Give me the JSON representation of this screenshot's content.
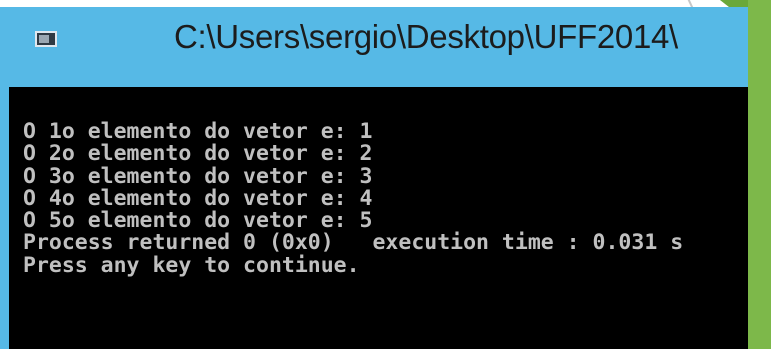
{
  "window": {
    "title": "C:\\Users\\sergio\\Desktop\\UFF2014\\"
  },
  "console": {
    "lines": [
      "O 1o elemento do vetor e: 1",
      "O 2o elemento do vetor e: 2",
      "O 3o elemento do vetor e: 3",
      "O 4o elemento do vetor e: 4",
      "O 5o elemento do vetor e: 5",
      "Process returned 0 (0x0)   execution time : 0.031 s",
      "Press any key to continue."
    ]
  },
  "colors": {
    "titlebar": "#56b9e6",
    "console_bg": "#000000",
    "console_text": "#c0c0c0",
    "slide_accent": "#7db84a"
  },
  "icons": {
    "window": "console-app-icon"
  }
}
